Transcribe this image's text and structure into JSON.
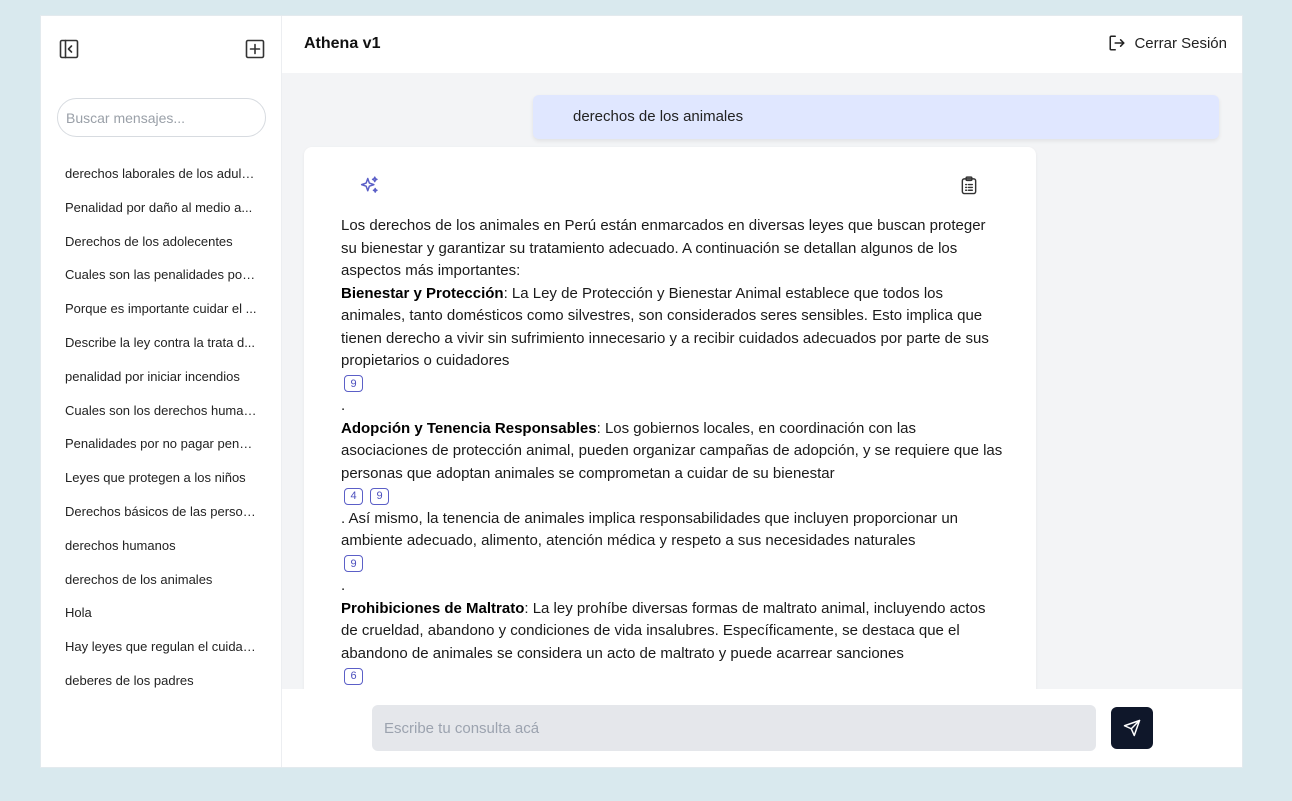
{
  "sidebar": {
    "search_placeholder": "Buscar mensajes...",
    "history": [
      "derechos laborales de los adultos",
      "Penalidad por daño al medio a...",
      "Derechos de los adolecentes",
      "Cuales son las penalidades por ...",
      "Porque es importante cuidar el ...",
      "Describe la ley contra la trata d...",
      "penalidad por iniciar incendios",
      "Cuales son los derechos human...",
      "Penalidades por no pagar pensi...",
      "Leyes que protegen a los niños",
      "Derechos básicos de las personas",
      "derechos humanos",
      "derechos de los animales",
      "Hola",
      "Hay leyes que regulan el cuidad...",
      "deberes de los padres"
    ]
  },
  "header": {
    "title": "Athena v1",
    "logout_label": "Cerrar Sesión"
  },
  "chat": {
    "user_message": "derechos de los animales",
    "answer": {
      "intro": "Los derechos de los animales en Perú están enmarcados en diversas leyes que buscan proteger su bienestar y garantizar su tratamiento adecuado. A continuación se detallan algunos de los aspectos más importantes:",
      "s1_title": "Bienestar y Protección",
      "s1_text": ": La Ley de Protección y Bienestar Animal establece que todos los animales, tanto domésticos como silvestres, son considerados seres sensibles. Esto implica que tienen derecho a vivir sin sufrimiento innecesario y a recibir cuidados adecuados por parte de sus propietarios o cuidadores",
      "s1_cites": [
        "9"
      ],
      "dot": ".",
      "s2_title": "Adopción y Tenencia Responsables",
      "s2_text": ": Los gobiernos locales, en coordinación con las asociaciones de protección animal, pueden organizar campañas de adopción, y se requiere que las personas que adoptan animales se comprometan a cuidar de su bienestar",
      "s2_cites": [
        "4",
        "9"
      ],
      "s2_more": ". Así mismo, la tenencia de animales implica responsabilidades que incluyen proporcionar un ambiente adecuado, alimento, atención médica y respeto a sus necesidades naturales",
      "s2_more_cites": [
        "9"
      ],
      "s3_title": "Prohibiciones de Maltrato",
      "s3_text": ": La ley prohíbe diversas formas de maltrato animal, incluyendo actos de crueldad, abandono y condiciones de vida insalubres. Específicamente, se destaca que el abandono de animales se considera un acto de maltrato y puede acarrear sanciones",
      "s3_cites": [
        "6"
      ]
    }
  },
  "composer": {
    "placeholder": "Escribe tu consulta acá"
  },
  "colors": {
    "background": "#d9e9ee",
    "user_bubble": "#e0e7ff",
    "accent": "#5b5fc7",
    "send_button": "#0f172a"
  },
  "icons": [
    "sidebar-collapse-icon",
    "new-chat-icon",
    "logout-icon",
    "sparkle-icon",
    "clipboard-icon",
    "send-icon"
  ]
}
